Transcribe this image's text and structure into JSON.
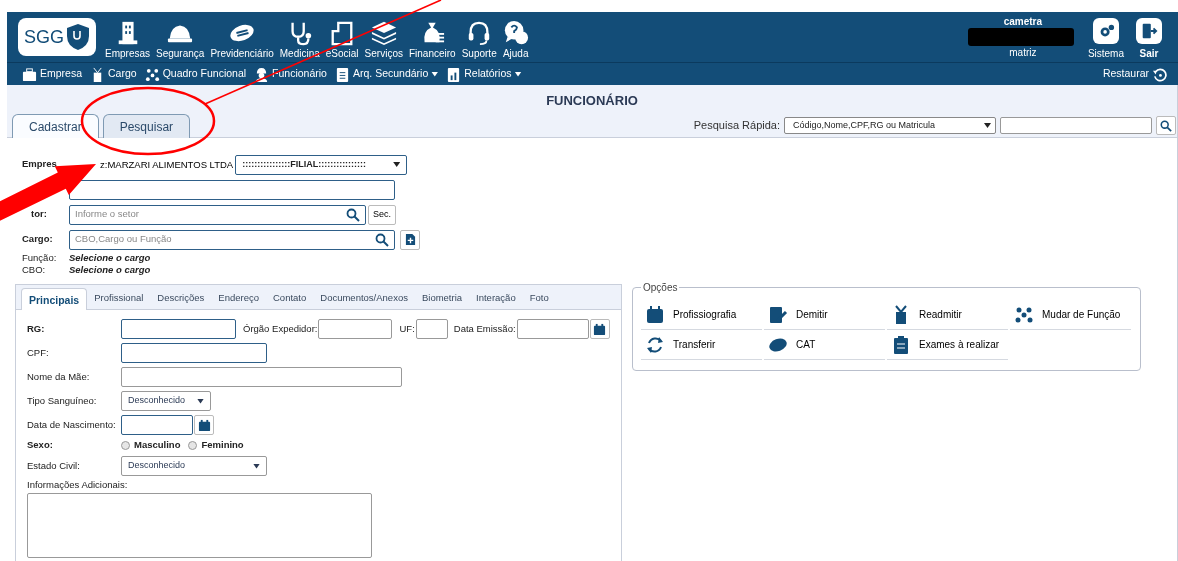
{
  "logo": {
    "text": "SGG"
  },
  "main_menu": [
    {
      "label": "Empresas"
    },
    {
      "label": "Segurança"
    },
    {
      "label": "Previdenciário"
    },
    {
      "label": "Medicina"
    },
    {
      "label": "eSocial"
    },
    {
      "label": "Serviços"
    },
    {
      "label": "Financeiro"
    },
    {
      "label": "Suporte"
    },
    {
      "label": "Ajuda"
    }
  ],
  "user": {
    "name": "cametra",
    "unit": "matriz"
  },
  "user_actions": [
    {
      "label": "Sistema",
      "bold": false
    },
    {
      "label": "Sair",
      "bold": true
    }
  ],
  "sub_menu": [
    {
      "label": "Empresa",
      "dropdown": false
    },
    {
      "label": "Cargo",
      "dropdown": false
    },
    {
      "label": "Quadro Funcional",
      "dropdown": false
    },
    {
      "label": "Funcionário",
      "dropdown": false
    },
    {
      "label": "Arq. Secundário",
      "dropdown": true
    },
    {
      "label": "Relatórios",
      "dropdown": true
    }
  ],
  "restore": {
    "label": "Restaurar"
  },
  "page_title": "FUNCIONÁRIO",
  "mode_tabs": [
    {
      "label": "Cadastrar",
      "selected": true
    },
    {
      "label": "Pesquisar",
      "selected": false
    }
  ],
  "quick_search": {
    "label": "Pesquisa Rápida:",
    "select": "Código,Nome,CPF,RG ou Matricula"
  },
  "header_form": {
    "company_label": "Empres",
    "company": "z:MARZARI ALIMENTOS LTDA",
    "branch": "::::::::::::::::FILIAL::::::::::::::::",
    "sector_label": "tor:",
    "sector_placeholder": "Informe o setor",
    "sector_button": "Sec.",
    "role_label": "Cargo:",
    "role_placeholder": "CBO,Cargo ou Função",
    "info": [
      {
        "label": "Função:",
        "value": "Selecione o cargo"
      },
      {
        "label": "CBO:",
        "value": "Selecione o cargo"
      }
    ]
  },
  "detail_tabs": [
    {
      "label": "Principais",
      "selected": true
    },
    {
      "label": "Profissional",
      "selected": false
    },
    {
      "label": "Descrições",
      "selected": false
    },
    {
      "label": "Endereço",
      "selected": false
    },
    {
      "label": "Contato",
      "selected": false
    },
    {
      "label": "Documentos/Anexos",
      "selected": false
    },
    {
      "label": "Biometria",
      "selected": false
    },
    {
      "label": "Interação",
      "selected": false
    },
    {
      "label": "Foto",
      "selected": false
    }
  ],
  "principais": {
    "rg_label": "RG:",
    "issuer_label": "Órgão Expedidor:",
    "uf_label": "UF:",
    "issue_date_label": "Data Emissão:",
    "cpf_label": "CPF:",
    "mother_label": "Nome da Mãe:",
    "blood_label": "Tipo Sanguíneo:",
    "blood_value": "Desconhecido",
    "birth_label": "Data de Nascimento:",
    "sex_label": "Sexo:",
    "sex_options": [
      {
        "label": "Masculino",
        "selected": false
      },
      {
        "label": "Feminino",
        "selected": false
      }
    ],
    "marital_label": "Estado Civil:",
    "marital_value": "Desconhecido",
    "notes_label": "Informações Adicionais:"
  },
  "options": {
    "title": "Opções",
    "items": [
      {
        "label": "Profissiografia"
      },
      {
        "label": "Demitir"
      },
      {
        "label": "Readmitir"
      },
      {
        "label": "Mudar de Função"
      },
      {
        "label": "Transferir"
      },
      {
        "label": "CAT"
      },
      {
        "label": "Exames à realizar"
      }
    ]
  }
}
